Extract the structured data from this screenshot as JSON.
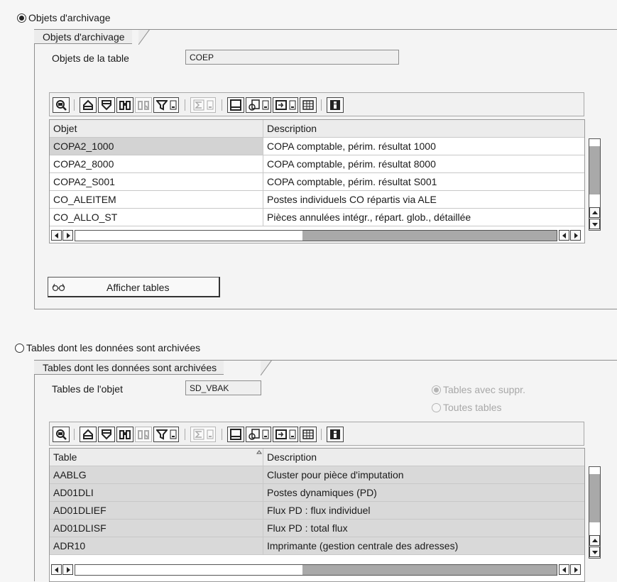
{
  "section1": {
    "radio_label": "Objets d'archivage",
    "group_title": "Objets d'archivage",
    "field_label": "Objets de la table",
    "field_value": "COEP",
    "grid": {
      "headers": [
        "Objet",
        "Description"
      ],
      "rows": [
        [
          "COPA2_1000",
          "COPA comptable, périm. résultat 1000"
        ],
        [
          "COPA2_8000",
          "COPA comptable, périm. résultat 8000"
        ],
        [
          "COPA2_S001",
          "COPA comptable, périm. résultat S001"
        ],
        [
          "CO_ALEITEM",
          "Postes individuels CO répartis via ALE"
        ],
        [
          "CO_ALLO_ST",
          "Pièces annulées intégr., répart. glob., détaillée"
        ]
      ]
    },
    "button_label": "Afficher tables"
  },
  "section2": {
    "radio_label": "Tables dont les données sont archivées",
    "group_title": "Tables dont les données sont archivées",
    "field_label": "Tables de l'objet",
    "field_value": "SD_VBAK",
    "option_with_deletion": "Tables avec suppr.",
    "option_all_tables": "Toutes tables",
    "grid": {
      "headers": [
        "Table",
        "Description"
      ],
      "rows": [
        [
          "AABLG",
          "Cluster pour pièce d'imputation"
        ],
        [
          "AD01DLI",
          "Postes dynamiques (PD)"
        ],
        [
          "AD01DLIEF",
          "Flux PD : flux individuel"
        ],
        [
          "AD01DLISF",
          "Flux PD : total flux"
        ],
        [
          "ADR10",
          "Imprimante (gestion centrale des adresses)"
        ]
      ]
    }
  },
  "colors": {
    "selected_row": "#d3d3d3",
    "grey_rows": "#d9d9d9",
    "scroll_thumb": "#a9a9a9"
  }
}
